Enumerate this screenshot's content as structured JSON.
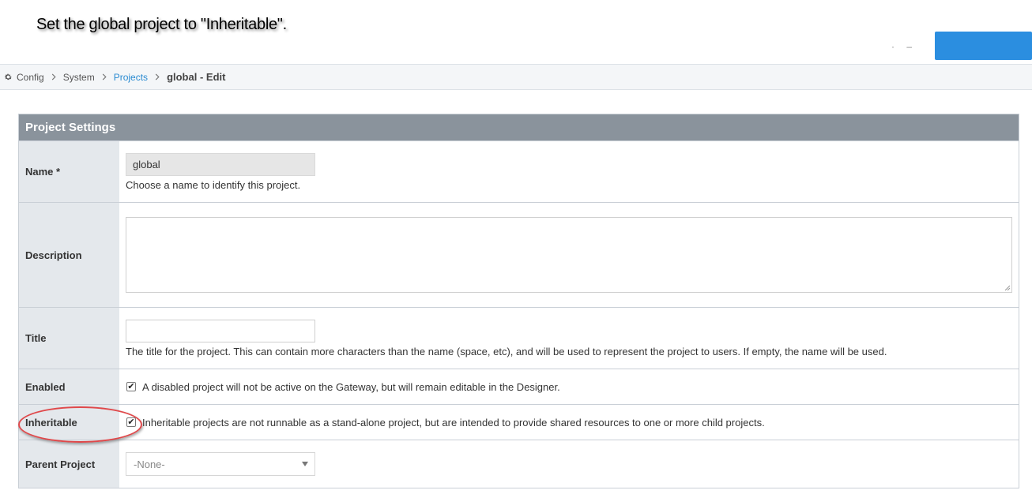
{
  "instruction": "Set the global project to \"Inheritable\".",
  "colors": {
    "accent": "#2b8ee0",
    "link": "#2a8bd1",
    "header_bg": "#8a939c",
    "label_bg": "#e4e8ec",
    "highlight": "#e0484a"
  },
  "breadcrumb": {
    "root": "Config",
    "root_icon": "gear-icon",
    "items": [
      "System",
      "Projects"
    ],
    "current": "global - Edit"
  },
  "form": {
    "header": "Project Settings",
    "name": {
      "label": "Name *",
      "value": "global",
      "help": "Choose a name to identify this project."
    },
    "description": {
      "label": "Description",
      "value": ""
    },
    "title": {
      "label": "Title",
      "value": "",
      "help": "The title for the project. This can contain more characters than the name (space, etc), and will be used to represent the project to users. If empty, the name will be used."
    },
    "enabled": {
      "label": "Enabled",
      "checked": true,
      "text": "A disabled project will not be active on the Gateway, but will remain editable in the Designer."
    },
    "inheritable": {
      "label": "Inheritable",
      "checked": true,
      "text": "Inheritable projects are not runnable as a stand-alone project, but are intended to provide shared resources to one or more child projects."
    },
    "parent_project": {
      "label": "Parent Project",
      "selected": "-None-"
    }
  },
  "check_glyph": "✔"
}
